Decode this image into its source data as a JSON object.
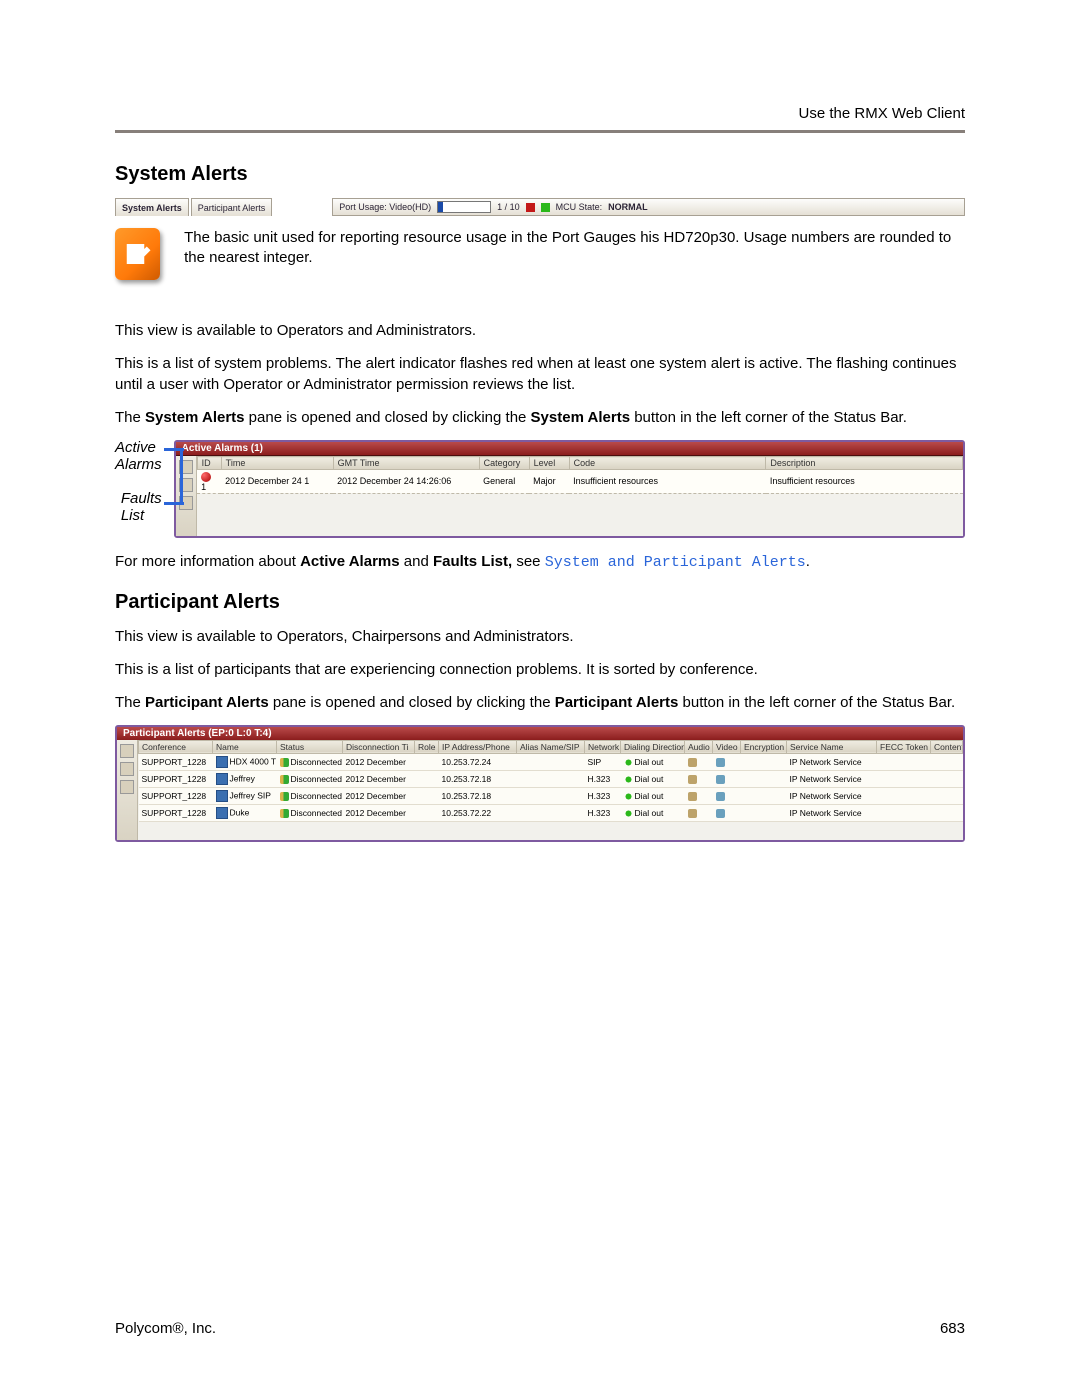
{
  "header": {
    "right": "Use the RMX Web Client"
  },
  "sections": {
    "systemAlerts": {
      "title": "System Alerts"
    },
    "participantAlerts": {
      "title": "Participant Alerts"
    }
  },
  "statusBar": {
    "tabs": {
      "system": "System Alerts",
      "participant": "Participant Alerts"
    },
    "usage": {
      "label_left": "Port Usage:  Video(HD)",
      "value": "1 / 10",
      "mcu_label": "MCU State:",
      "mcu_value": "NORMAL"
    }
  },
  "note": {
    "text": "The basic unit used for reporting resource usage in the Port Gauges his HD720p30. Usage numbers are rounded to the nearest integer."
  },
  "paragraphs": {
    "sa1": "This view is available to Operators and Administrators.",
    "sa2": "This is a list of system problems. The alert indicator flashes red when at least one system alert is active. The flashing continues until a user with Operator or Administrator permission reviews the list.",
    "sa3_a": "The ",
    "sa3_b": "System Alerts",
    "sa3_c": " pane is opened and closed by clicking the ",
    "sa3_d": "System Alerts",
    "sa3_e": " button in the left corner of the Status Bar.",
    "pa1": "This view is available to Operators, Chairpersons and Administrators.",
    "pa2": "This is a list of participants that are experiencing connection problems. It is sorted by conference.",
    "pa3_a": "The ",
    "pa3_b": "Participant Alerts",
    "pa3_c": " pane is opened and closed by clicking the ",
    "pa3_d": "Participant Alerts",
    "pa3_e": " button in the left corner of the Status Bar."
  },
  "activeAlarms": {
    "callouts": {
      "a1": "Active",
      "a2": "Alarms",
      "b1": "Faults",
      "b2": "List"
    },
    "title": "Active Alarms (1)",
    "columns": [
      "ID",
      "Time",
      "GMT Time",
      "Category",
      "Level",
      "Code",
      "Description"
    ],
    "rows": [
      {
        "id": "1",
        "time": "2012 December 24 1",
        "gmt": "2012 December 24 14:26:06",
        "category": "General",
        "level": "Major",
        "code": "Insufficient resources",
        "desc": "Insufficient resources"
      }
    ]
  },
  "xref": {
    "pre": "For more information about ",
    "b1": "Active Alarms",
    "mid": " and ",
    "b2": "Faults List,",
    "post": " see ",
    "link": "System and Participant Alerts",
    "end": "."
  },
  "participantTable": {
    "title": "Participant Alerts (EP:0 L:0 T:4)",
    "columns": [
      "Conference",
      "Name",
      "Status",
      "Disconnection Ti",
      "Role",
      "IP Address/Phone",
      "Alias Name/SIP",
      "Network",
      "Dialing Direction",
      "Audio",
      "Video",
      "Encryption",
      "Service Name",
      "FECC Token",
      "Content Token"
    ],
    "rows": [
      {
        "conf": "SUPPORT_1228",
        "name": "HDX 4000 T",
        "status": "Disconnected",
        "disc": "2012 December",
        "ip": "10.253.72.24",
        "net": "SIP",
        "dir": "Dial out",
        "svc": "IP Network Service"
      },
      {
        "conf": "SUPPORT_1228",
        "name": "Jeffrey",
        "status": "Disconnected",
        "disc": "2012 December",
        "ip": "10.253.72.18",
        "net": "H.323",
        "dir": "Dial out",
        "svc": "IP Network Service"
      },
      {
        "conf": "SUPPORT_1228",
        "name": "Jeffrey SIP",
        "status": "Disconnected",
        "disc": "2012 December",
        "ip": "10.253.72.18",
        "net": "H.323",
        "dir": "Dial out",
        "svc": "IP Network Service"
      },
      {
        "conf": "SUPPORT_1228",
        "name": "Duke",
        "status": "Disconnected",
        "disc": "2012 December",
        "ip": "10.253.72.22",
        "net": "H.323",
        "dir": "Dial out",
        "svc": "IP Network Service"
      }
    ]
  },
  "footer": {
    "left": "Polycom®, Inc.",
    "right": "683"
  }
}
